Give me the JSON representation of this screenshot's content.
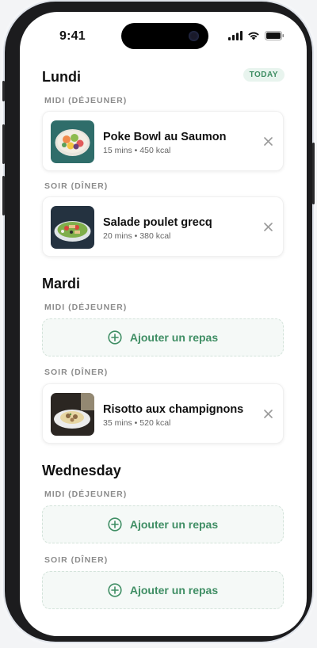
{
  "status_bar": {
    "time": "9:41"
  },
  "days": [
    {
      "name": "Lundi",
      "badge": "TODAY",
      "slots": [
        {
          "label": "MIDI (DÉJEUNER)",
          "meal": {
            "name": "Poke Bowl au Saumon",
            "meta": "15 mins • 450 kcal",
            "image": "poke-bowl"
          }
        },
        {
          "label": "SOIR (DÎNER)",
          "meal": {
            "name": "Salade poulet grecq",
            "meta": "20 mins • 380 kcal",
            "image": "greek-salad"
          }
        }
      ]
    },
    {
      "name": "Mardi",
      "slots": [
        {
          "label": "MIDI (DÉJEUNER)",
          "add_label": "Ajouter un repas"
        },
        {
          "label": "SOIR (DÎNER)",
          "meal": {
            "name": "Risotto aux champignons",
            "meta": "35 mins • 520 kcal",
            "image": "risotto"
          }
        }
      ]
    },
    {
      "name": "Wednesday",
      "slots": [
        {
          "label": "MIDI (DÉJEUNER)",
          "add_label": "Ajouter un repas"
        },
        {
          "label": "SOIR (DÎNER)",
          "add_label": "Ajouter un repas"
        }
      ]
    }
  ],
  "colors": {
    "accent": "#3f8e64",
    "badge_bg": "#e8f4ee",
    "muted": "#8b8b8b"
  }
}
